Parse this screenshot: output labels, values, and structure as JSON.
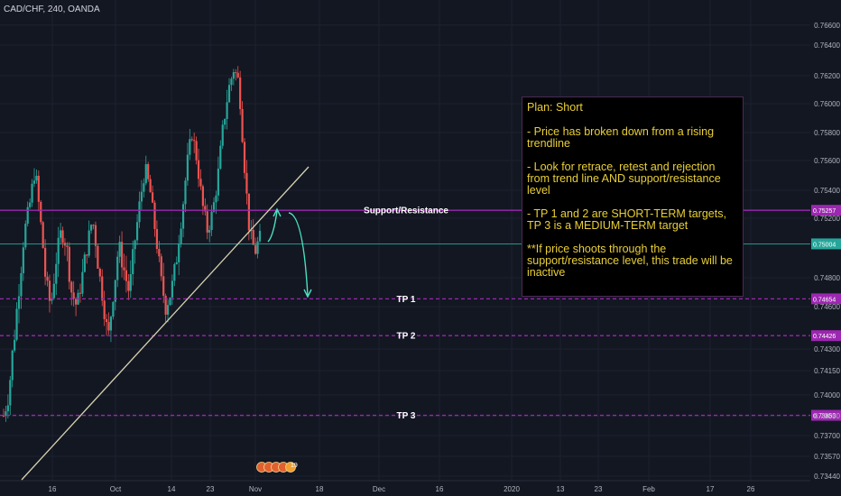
{
  "header": {
    "symbol": "CAD/CHF, 240, OANDA"
  },
  "colors": {
    "background": "#131722",
    "grid": "#1e2230",
    "bull": "#26a69a",
    "bear": "#ef5350",
    "level_line": "#9c27b0",
    "trendline": "#d6d2b0",
    "arrow": "#4be0c0",
    "current_price": "#26a69a",
    "plan_text": "#e9cf36"
  },
  "plan": {
    "title": "Plan: Short",
    "lines": [
      "- Price has broken down from a rising trendline",
      "- Look for retrace, retest and rejection from trend line AND support/resistance level",
      "- TP 1 and 2 are SHORT-TERM targets, TP 3 is a MEDIUM-TERM target",
      "**If price shoots through the support/resistance level, this trade will be inactive"
    ]
  },
  "chart_data": {
    "type": "candlestick",
    "title": "CAD/CHF, 240, OANDA",
    "yaxis_ticks": [
      "0.76600",
      "0.76400",
      "0.76200",
      "0.76000",
      "0.75800",
      "0.75600",
      "0.75400",
      "0.75200",
      "0.74800",
      "0.74600",
      "0.74300",
      "0.74150",
      "0.74000",
      "0.73850",
      "0.73700",
      "0.73570",
      "0.73440"
    ],
    "yrange": [
      0.734,
      0.767
    ],
    "xaxis_ticks": [
      "16",
      "Oct",
      "14",
      "23",
      "Nov",
      "18",
      "Dec",
      "16",
      "2020",
      "13",
      "23",
      "Feb",
      "17",
      "26"
    ],
    "price_path": [
      0.7385,
      0.74,
      0.744,
      0.7475,
      0.751,
      0.753,
      0.7555,
      0.752,
      0.748,
      0.746,
      0.749,
      0.751,
      0.75,
      0.747,
      0.746,
      0.748,
      0.75,
      0.752,
      0.749,
      0.7465,
      0.744,
      0.747,
      0.75,
      0.7485,
      0.747,
      0.75,
      0.753,
      0.7555,
      0.754,
      0.751,
      0.748,
      0.746,
      0.747,
      0.749,
      0.752,
      0.7555,
      0.758,
      0.756,
      0.753,
      0.751,
      0.7525,
      0.755,
      0.7585,
      0.761,
      0.7625,
      0.7615,
      0.756,
      0.751,
      0.7495,
      0.7505
    ],
    "levels": [
      {
        "name": "Support/Resistance",
        "price": 0.75257,
        "price_label": "0.75257"
      },
      {
        "name": "TP 1",
        "price": 0.74654,
        "price_label": "0.74654"
      },
      {
        "name": "TP 2",
        "price": 0.74426,
        "price_label": "0.74426"
      },
      {
        "name": "TP 3",
        "price": 0.73853,
        "price_label": "0.73853"
      }
    ],
    "current_price": {
      "value": 0.75004,
      "label": "0.75004"
    },
    "annotations": {
      "event_marker": "19"
    }
  }
}
